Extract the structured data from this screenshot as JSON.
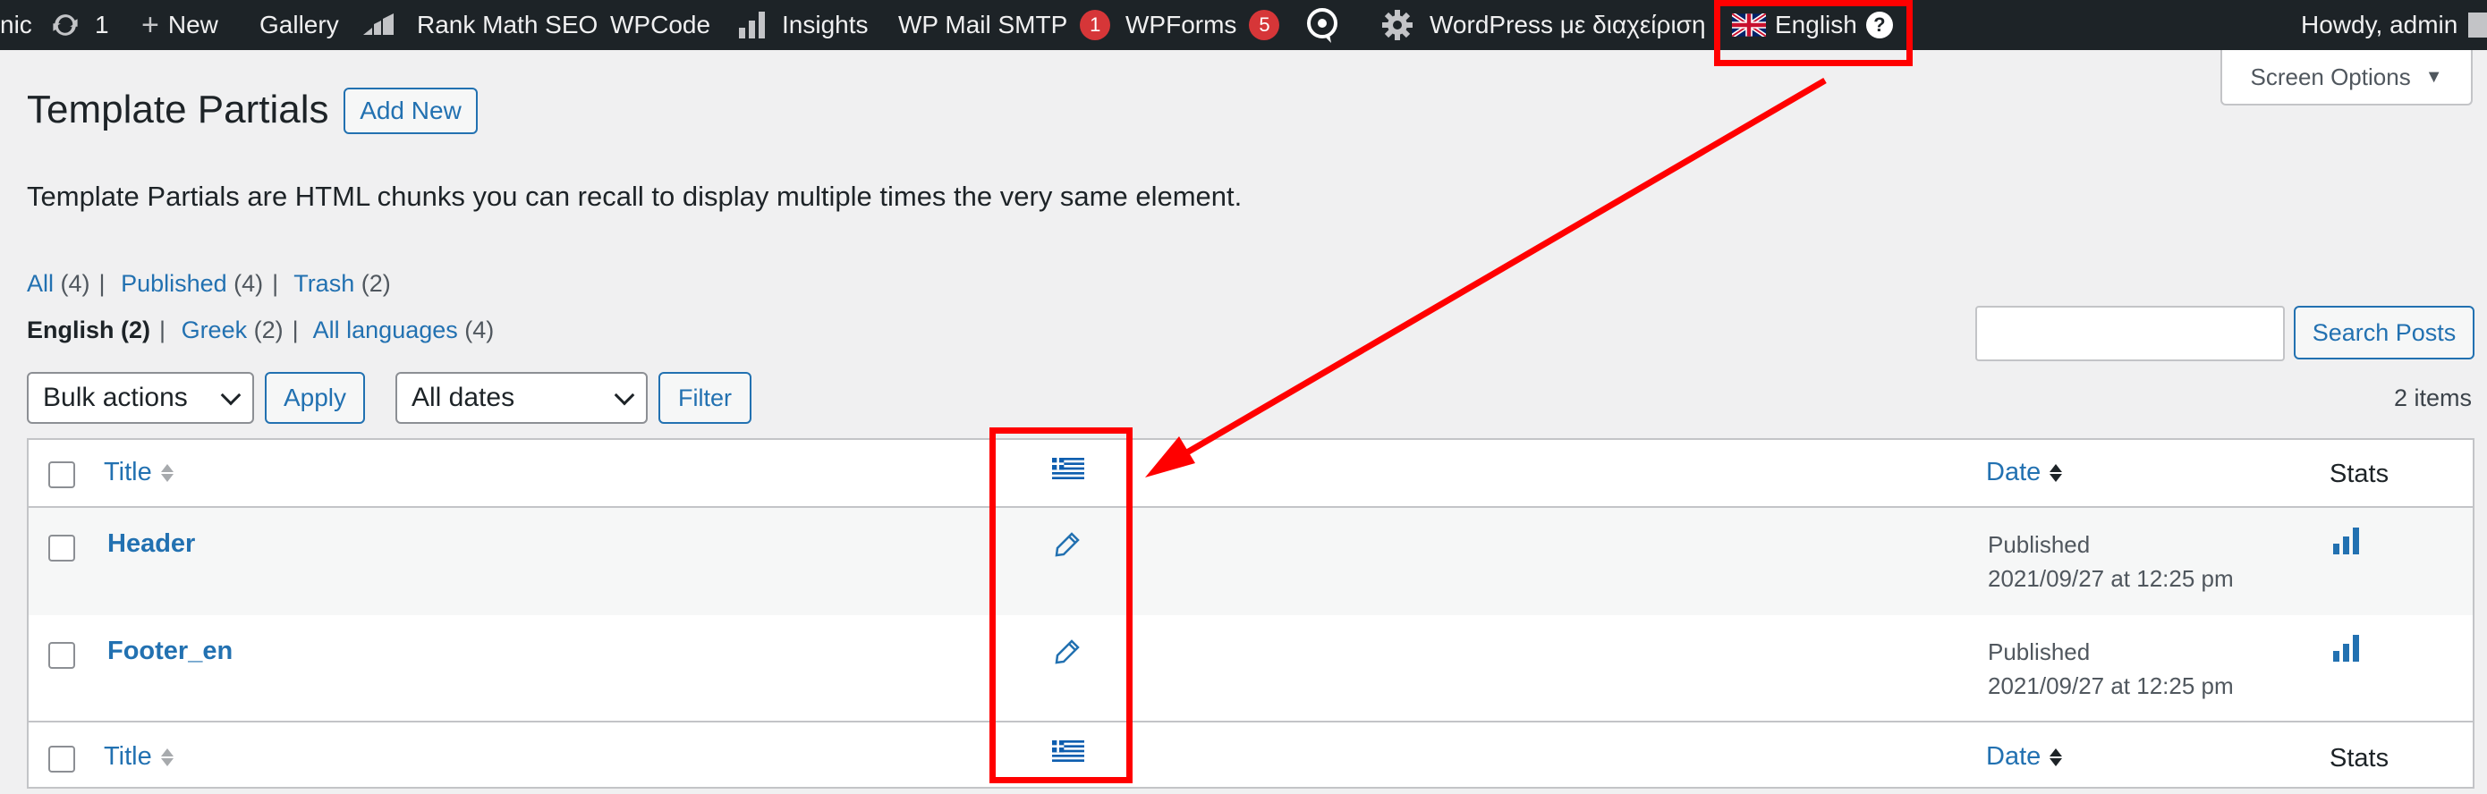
{
  "admin_bar": {
    "site_fragment": "nic",
    "updates_count": "1",
    "new_label": "New",
    "gallery_label": "Gallery",
    "rank_math_label": "Rank Math SEO",
    "wpcode_label": "WPCode",
    "insights_label": "Insights",
    "wp_mail_smtp_label": "WP Mail SMTP",
    "wp_mail_smtp_badge": "1",
    "wpforms_label": "WPForms",
    "wpforms_badge": "5",
    "wordpress_admin_label": "WordPress με διαχείριση",
    "language_label": "English",
    "language_help": "?",
    "howdy_label": "Howdy, admin"
  },
  "page": {
    "title": "Template Partials",
    "add_new_label": "Add New",
    "screen_options_label": "Screen Options",
    "description": "Template Partials are HTML chunks you can recall to display multiple times the very same element."
  },
  "status_filters": [
    {
      "label": "All",
      "count": "(4)"
    },
    {
      "label": "Published",
      "count": "(4)"
    },
    {
      "label": "Trash",
      "count": "(2)"
    }
  ],
  "language_filters": [
    {
      "label": "English",
      "count": "(2)"
    },
    {
      "label": "Greek",
      "count": "(2)"
    },
    {
      "label": "All languages",
      "count": "(4)"
    }
  ],
  "search": {
    "button_label": "Search Posts",
    "value": ""
  },
  "tablenav": {
    "bulk_actions_label": "Bulk actions",
    "apply_label": "Apply",
    "dates_label": "All dates",
    "filter_label": "Filter",
    "items_count": "2 items"
  },
  "table": {
    "columns": {
      "title": "Title",
      "date": "Date",
      "stats": "Stats"
    },
    "rows": [
      {
        "title": "Header",
        "status": "Published",
        "date": "2021/09/27 at 12:25 pm"
      },
      {
        "title": "Footer_en",
        "status": "Published",
        "date": "2021/09/27 at 12:25 pm"
      }
    ]
  },
  "colors": {
    "admin_bar_bg": "#1d2327",
    "link_blue": "#2271b1",
    "badge_red": "#d63638",
    "annotation_red": "#ff0000",
    "greek_flag_blue": "#0d5eaf"
  },
  "icons": [
    "updates-icon",
    "plus-icon",
    "rank-math-icon",
    "insights-icon",
    "chat-icon",
    "gear-icon",
    "uk-flag-icon",
    "greek-flag-icon",
    "pencil-icon",
    "stats-icon"
  ]
}
